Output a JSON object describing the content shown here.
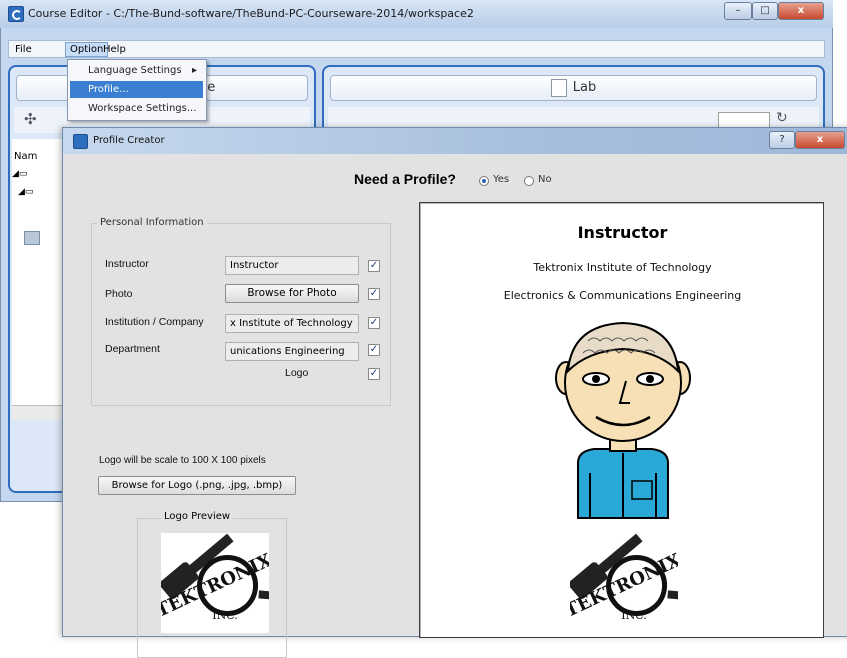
{
  "window": {
    "title": "Course Editor - C:/The-Bund-software/TheBund-PC-Courseware-2014/workspace2",
    "minimize": "–",
    "maximize": "□",
    "close": "x"
  },
  "menubar": {
    "items": [
      {
        "label": "File"
      },
      {
        "label": "Option"
      },
      {
        "label": "Help"
      }
    ]
  },
  "option_menu": {
    "items": [
      {
        "label": "Language Settings",
        "submenu": "▸"
      },
      {
        "label": "Profile..."
      },
      {
        "label": "Workspace Settings..."
      }
    ]
  },
  "panels": {
    "left_header_fragment": "ge",
    "right_header": "Lab",
    "tree_header": "Nam"
  },
  "dialog": {
    "title": "Profile Creator",
    "help": "?",
    "close": "x",
    "need_profile_label": "Need a Profile?",
    "radio_yes": "Yes",
    "radio_no": "No",
    "yes_selected": true,
    "personal_info_title": "Personal Information",
    "fields": [
      {
        "label": "Instructor",
        "value": "Instructor",
        "checked": true
      },
      {
        "label": "Photo",
        "button": "Browse for Photo",
        "checked": true
      },
      {
        "label": "Institution / Company",
        "value": "x Institute of Technology",
        "checked": true
      },
      {
        "label": "Department",
        "value": "unications Engineering",
        "checked": true
      },
      {
        "label": "Logo",
        "checked": true
      }
    ],
    "checkmark": "✓",
    "scale_note": "Logo will be scale to 100 X 100 pixels",
    "browse_logo_button": "Browse for Logo (.png, .jpg, .bmp)",
    "logo_preview_title": "Logo Preview"
  },
  "preview": {
    "name": "Instructor",
    "institution": "Tektronix Institute of Technology",
    "department": "Electronics & Communications Engineering"
  },
  "logo": {
    "text": "TEKTRONIX",
    "sub": "INC."
  },
  "colors": {
    "accent": "#2f6dbf",
    "selection": "#3a7fd1",
    "face": "#f7e0b5",
    "shirt": "#2aa8d8"
  }
}
